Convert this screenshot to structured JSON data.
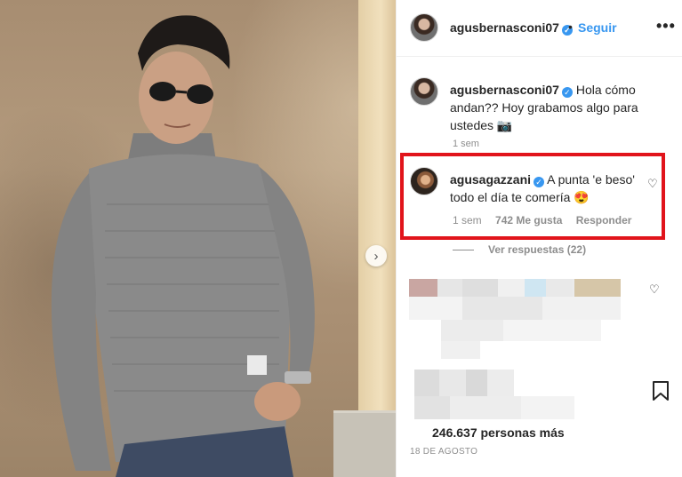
{
  "post": {
    "username": "agusbernasconi07",
    "follow_label": "Seguir",
    "separator": "•",
    "more_label": "•••",
    "caption_text": "Hola cómo andan?? Hoy grabamos algo para ustedes 📷",
    "caption_time": "1 sem",
    "likes_text": "246.637 personas más",
    "date_text": "18 DE AGOSTO"
  },
  "highlight_comment": {
    "username": "agusagazzani",
    "text": "A punta 'e beso' todo el día te comería 😍",
    "time": "1 sem",
    "likes": "742 Me gusta",
    "reply_label": "Responder"
  },
  "replies": {
    "label": "Ver respuestas (22)"
  },
  "icons": {
    "verified": "verified-badge-icon",
    "heart": "heart-outline-icon",
    "bookmark": "bookmark-outline-icon",
    "next": "chevron-right-icon"
  },
  "colors": {
    "accent_blue": "#3897f0",
    "highlight_red": "#e1141b",
    "secondary_text": "#8e8e8e"
  }
}
